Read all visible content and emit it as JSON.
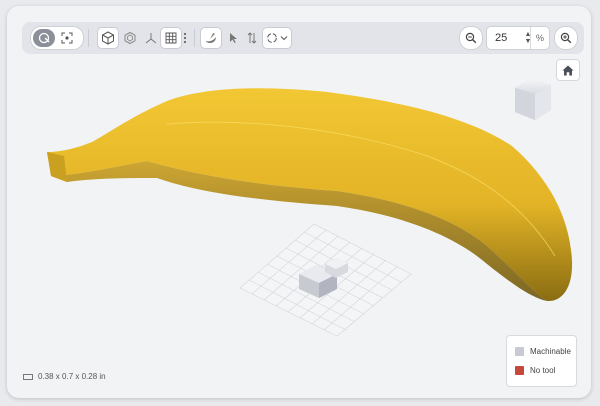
{
  "toolbar": {
    "zoom_value": "25",
    "zoom_unit": "%",
    "icons": [
      "select-icon",
      "fit-icon",
      "cube-view-icon",
      "section-view-icon",
      "axes-icon",
      "grid-icon",
      "more-icon",
      "part-icon",
      "pointer-icon",
      "measure-icon",
      "orbit-icon",
      "chevron-down-icon",
      "zoom-out-icon",
      "zoom-in-icon"
    ]
  },
  "viewport": {
    "part_color": "#e8b928",
    "home_icon": "home-icon"
  },
  "legend": {
    "items": [
      {
        "label": "Machinable",
        "color": "#c7c9d3"
      },
      {
        "label": "No tool",
        "color": "#c4493a"
      }
    ]
  },
  "dimensions": {
    "text": "0.38 x 0.7 x 0.28 in"
  }
}
